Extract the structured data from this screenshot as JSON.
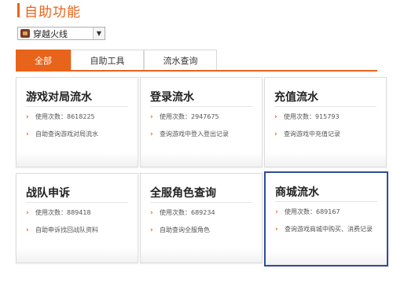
{
  "page_title": "自助功能",
  "game_select": {
    "value": "穿越火线",
    "icon": "game-logo-icon"
  },
  "tabs": [
    {
      "label": "全部",
      "active": true
    },
    {
      "label": "自助工具",
      "active": false
    },
    {
      "label": "流水查询",
      "active": false
    }
  ],
  "cards": [
    {
      "title": "游戏对局流水",
      "count_label": "使用次数：8618225",
      "desc": "自助查询游戏对局流水"
    },
    {
      "title": "登录流水",
      "count_label": "使用次数：2947675",
      "desc": "查询游戏中登入登出记录"
    },
    {
      "title": "充值流水",
      "count_label": "使用次数：915793",
      "desc": "查询游戏中充值记录"
    },
    {
      "title": "战队申诉",
      "count_label": "使用次数：889418",
      "desc": "自助申诉找回战队资料"
    },
    {
      "title": "全服角色查询",
      "count_label": "使用次数：689234",
      "desc": "自助查询全服角色"
    },
    {
      "title": "商城流水",
      "count_label": "使用次数：689167",
      "desc": "查询游戏商城中购买、消费记录"
    }
  ],
  "colors": {
    "accent": "#e8641b",
    "selected_border": "#2f4c9c"
  }
}
